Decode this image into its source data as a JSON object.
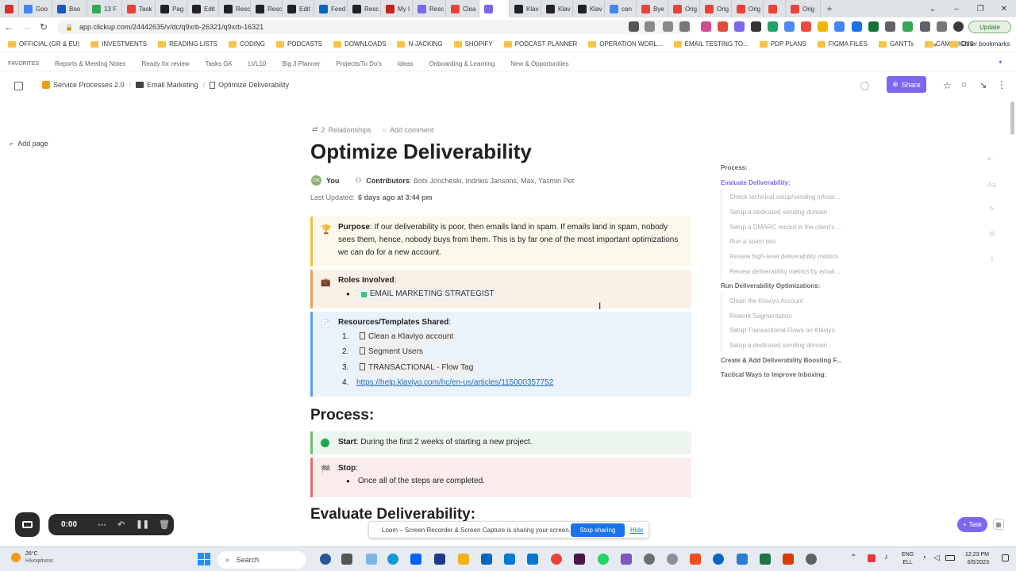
{
  "browser": {
    "tabs": [
      {
        "label": "",
        "color": "#d93025"
      },
      {
        "label": "Goo",
        "color": "#4285f4"
      },
      {
        "label": "Boo",
        "color": "#1a56c4"
      },
      {
        "label": "13 F",
        "color": "#34a853"
      },
      {
        "label": "Task",
        "color": "#e94235"
      },
      {
        "label": "Pag",
        "color": "#222222"
      },
      {
        "label": "Edit",
        "color": "#222222"
      },
      {
        "label": "Resc",
        "color": "#222222"
      },
      {
        "label": "Resc",
        "color": "#222222"
      },
      {
        "label": "Edit",
        "color": "#222222"
      },
      {
        "label": "Feed",
        "color": "#0a66c2"
      },
      {
        "label": "Resc",
        "color": "#222222"
      },
      {
        "label": "My I",
        "color": "#c5221f"
      },
      {
        "label": "Resc",
        "color": "#7b68ee"
      },
      {
        "label": "Clea",
        "color": "#e94235"
      },
      {
        "label": "",
        "color": "#7b68ee"
      },
      {
        "label": "Klav",
        "color": "#222222"
      },
      {
        "label": "Klav",
        "color": "#222222"
      },
      {
        "label": "Klav",
        "color": "#222222"
      },
      {
        "label": "can",
        "color": "#4285f4"
      },
      {
        "label": "Bye",
        "color": "#ea4335"
      },
      {
        "label": "Orig",
        "color": "#ea4335"
      },
      {
        "label": "Orig",
        "color": "#ea4335"
      },
      {
        "label": "Orig",
        "color": "#ea4335"
      },
      {
        "label": "",
        "color": "#ea4335"
      },
      {
        "label": "Orig",
        "color": "#ea4335"
      }
    ],
    "new_tab": "+",
    "url": "app.clickup.com/24442635/v/dc/q9xrb-26321/q9xrb-16321",
    "update_label": "Update",
    "bookmarks": [
      "OFFICIAL (GR & EU)",
      "INVESTMENTS",
      "READING LISTS",
      "CODING",
      "PODCASTS",
      "DOWNLOADS",
      "N-JACKING",
      "SHOPIFY",
      "PODCAST PLANNER",
      "OPERATION WORL...",
      "EMAIL TESTING TO...",
      "PDP PLANS",
      "FIGMA FILES",
      "GANTTs",
      "CAMPAIGNS"
    ],
    "bookmarks_more": "»",
    "other_bookmarks": "Other bookmarks"
  },
  "favorites": {
    "label": "FAVORITES",
    "items": [
      "Reports & Meeting Notes",
      "Ready for review",
      "Tasks GK",
      "LVL10",
      "Big 3 Planner",
      "Projects/To Do's",
      "Ideas",
      "Onboarding & Learning",
      "New & Opportunities"
    ]
  },
  "header": {
    "crumbs": [
      "Service Processes 2.0",
      "Email Marketing",
      "Optimize Deliverability"
    ],
    "separator": "/",
    "share_label": "Share",
    "add_page": "Add page"
  },
  "doc": {
    "relationships_count": "2",
    "relationships_label": "Relationships",
    "add_comment": "Add comment",
    "title": "Optimize Deliverability",
    "author_initials": "GK",
    "author": "You",
    "contributors_label": "Contributors",
    "contributors": ": Bobi Joncheski, Indrikis Jansons, Max, Yasmin Pet",
    "last_updated_label": "Last Updated:",
    "last_updated": "6 days ago at 3:44 pm",
    "purpose_label": "Purpose",
    "purpose_text": ": If our deliverability is poor, then emails land in spam. If emails land in spam, nobody sees them, hence, nobody buys from them. This is by far one of the most important optimizations we can do for a new account.",
    "roles_label": "Roles Involved",
    "roles_colon": ":",
    "role_tag": "EMAIL MARKETING STRATEGIST",
    "resources_label": "Resources/Templates Shared",
    "resources_colon": ":",
    "resources": [
      {
        "num": "1.",
        "label": "Clean a Klaviyo account"
      },
      {
        "num": "2.",
        "label": "Segment Users"
      },
      {
        "num": "3.",
        "label": "TRANSACTIONAL - Flow Tag"
      }
    ],
    "resource_link_num": "4.",
    "resource_link": "https://help.klaviyo.com/hc/en-us/articles/115000357752",
    "process_heading": "Process:",
    "start_label": "Start",
    "start_text": ": During the first 2 weeks of starting a new project.",
    "stop_label": "Stop",
    "stop_colon": ":",
    "stop_text": "Once all of the steps are completed.",
    "evaluate_heading": "Evaluate Deliverability:"
  },
  "toc": {
    "items": [
      {
        "label": "Process:",
        "kind": "head"
      },
      {
        "label": "Evaluate Deliverability:",
        "kind": "active"
      },
      {
        "label": "Check technical setup/sending infrast...",
        "kind": "sub"
      },
      {
        "label": "Setup a dedicated sending domain",
        "kind": "sub"
      },
      {
        "label": "Setup a DMARC record in the client's ...",
        "kind": "sub"
      },
      {
        "label": "Run a spam test",
        "kind": "sub"
      },
      {
        "label": "Review high-level deliverability metrics",
        "kind": "sub"
      },
      {
        "label": "Review deliverability metrics by email...",
        "kind": "sub"
      },
      {
        "label": "Run Deliverability Optimizations:",
        "kind": "head"
      },
      {
        "label": "Clean the Klaviyo Account",
        "kind": "sub"
      },
      {
        "label": "Rework Segmentation",
        "kind": "sub"
      },
      {
        "label": "Setup Transactional Flows on Klaviyo",
        "kind": "sub"
      },
      {
        "label": "Setup a dedicated sending domain",
        "kind": "sub"
      },
      {
        "label": "Create & Add Deliverability Boosting F...",
        "kind": "head"
      },
      {
        "label": "Tactical Ways to Improve Inboxing:",
        "kind": "head"
      }
    ]
  },
  "loom": {
    "timer": "0:00",
    "notice": "Loom – Screen Recorder & Screen Capture is sharing your screen.",
    "stop_sharing": "Stop sharing",
    "hide": "Hide",
    "task_label": "Task"
  },
  "taskbar": {
    "weather_temp": "26°C",
    "weather_desc": "Ηλιοφάνεια",
    "search": "Search",
    "lang_top": "ENG",
    "lang_bottom": "ELL",
    "time": "12:23 PM",
    "date": "6/5/2023"
  },
  "colors": {
    "accent": "#7b68ee",
    "purpose_bg": "#fdf8ec",
    "purpose_border": "#f0c040",
    "roles_bg": "#fbf0e6",
    "roles_border": "#e8a25a",
    "resources_bg": "#eaf2fb",
    "resources_border": "#5c9ee6",
    "start_bg": "#edf6ee",
    "start_border": "#6cbf73",
    "stop_bg": "#fbecec",
    "stop_border": "#e07070",
    "role_tag_green": "#2ecc71"
  }
}
